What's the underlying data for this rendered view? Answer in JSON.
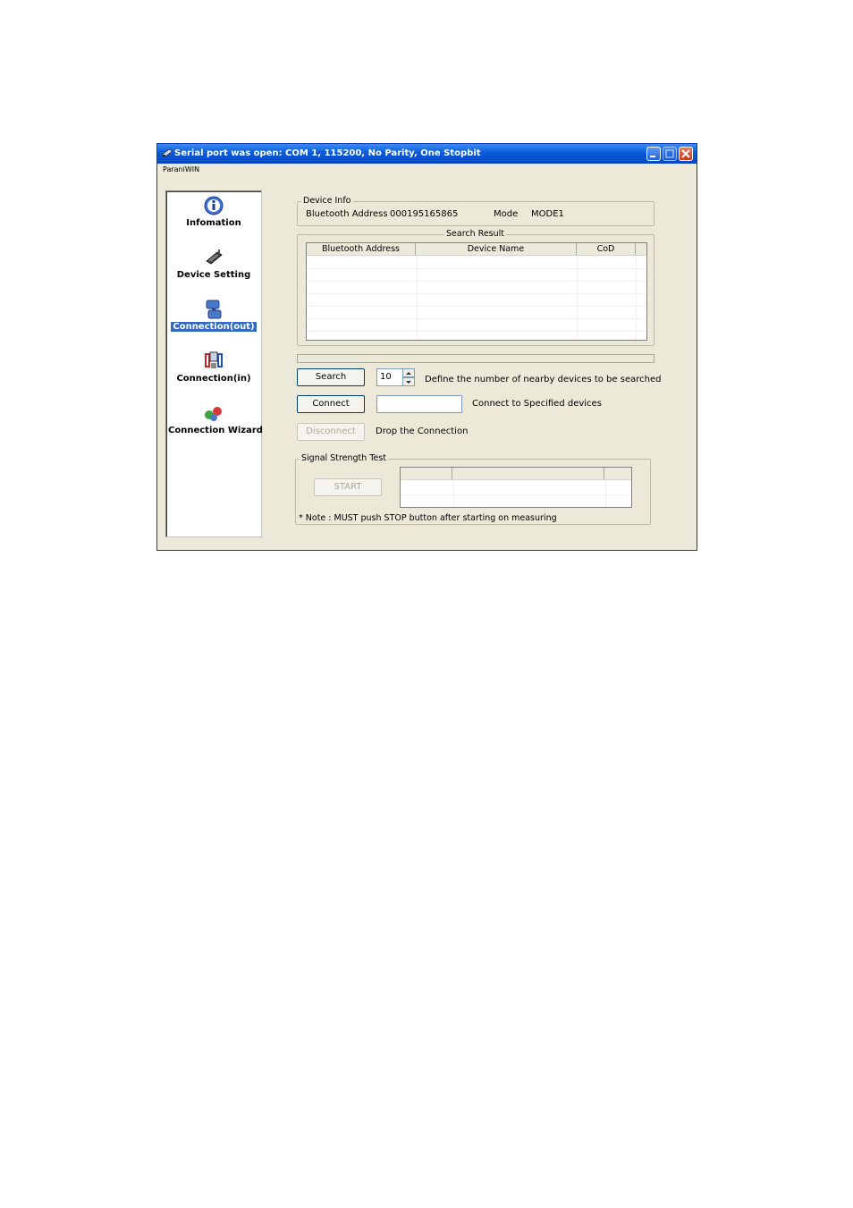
{
  "window": {
    "title": "Serial port was open: COM 1, 115200, No Parity, One Stopbit",
    "menu_label": "ParaniWIN"
  },
  "sidebar": {
    "items": [
      {
        "label": "Infomation",
        "icon": "information-icon",
        "selected": false
      },
      {
        "label": "Device Setting",
        "icon": "device-setting-icon",
        "selected": false
      },
      {
        "label": "Connection(out)",
        "icon": "connection-out-icon",
        "selected": true
      },
      {
        "label": "Connection(in)",
        "icon": "connection-in-icon",
        "selected": false
      },
      {
        "label": "Connection Wizard",
        "icon": "connection-wizard-icon",
        "selected": false
      }
    ]
  },
  "device_info": {
    "legend": "Device Info",
    "address_label": "Bluetooth Address",
    "address_value": "000195165865",
    "mode_label": "Mode",
    "mode_value": "MODE1"
  },
  "search_result": {
    "legend": "Search Result",
    "columns": [
      "Bluetooth Address",
      "Device Name",
      "CoD"
    ]
  },
  "controls": {
    "search_label": "Search",
    "search_count": "10",
    "search_desc": "Define the number of nearby devices to be searched",
    "connect_label": "Connect",
    "connect_input": "",
    "connect_desc": "Connect to Specified devices",
    "disconnect_label": "Disconnect",
    "disconnect_desc": "Drop the Connection"
  },
  "signal_test": {
    "legend": "Signal Strength Test",
    "start_label": "START",
    "note": "* Note : MUST push STOP button after starting on measuring"
  },
  "colors": {
    "titlebar": "#0a5bd8",
    "window_bg": "#ece9d8",
    "selection": "#316ac5"
  }
}
